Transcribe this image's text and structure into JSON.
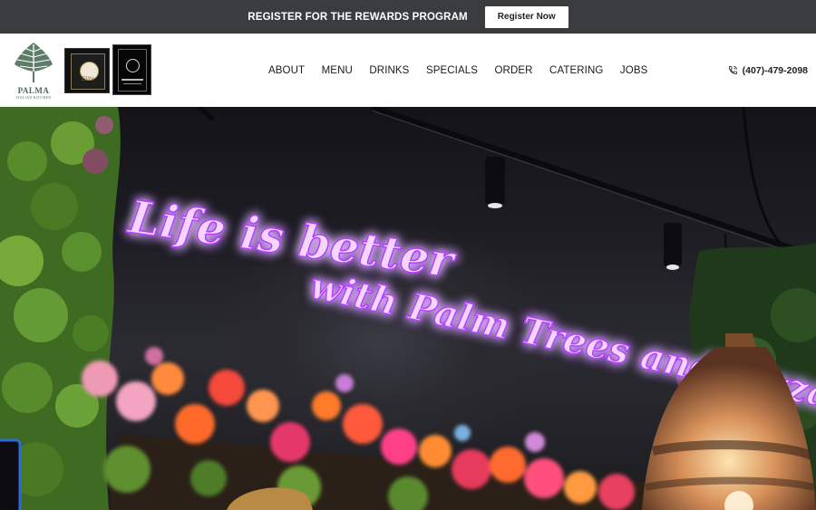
{
  "promo": {
    "text": "REGISTER FOR THE REWARDS PROGRAM",
    "button": "Register Now"
  },
  "brand": {
    "name": "PALMA",
    "tagline": "ITALIAN KITCHEN",
    "logo_color": "#4d6b5a"
  },
  "awards": [
    {
      "icon": "elite-award-plaque",
      "text": "Elite"
    },
    {
      "icon": "excellence-award-plaque"
    }
  ],
  "nav": {
    "items": [
      "ABOUT",
      "MENU",
      "DRINKS",
      "SPECIALS",
      "ORDER",
      "CATERING",
      "JOBS"
    ]
  },
  "contact": {
    "phone_icon": "phone-icon",
    "phone": "(407)-479-2098"
  },
  "hero": {
    "neon_line1": "Life is better",
    "neon_line2": "with Palm Trees and Pizza",
    "neon_color": "#e9b8ff",
    "glow_color": "#9b2cff"
  }
}
